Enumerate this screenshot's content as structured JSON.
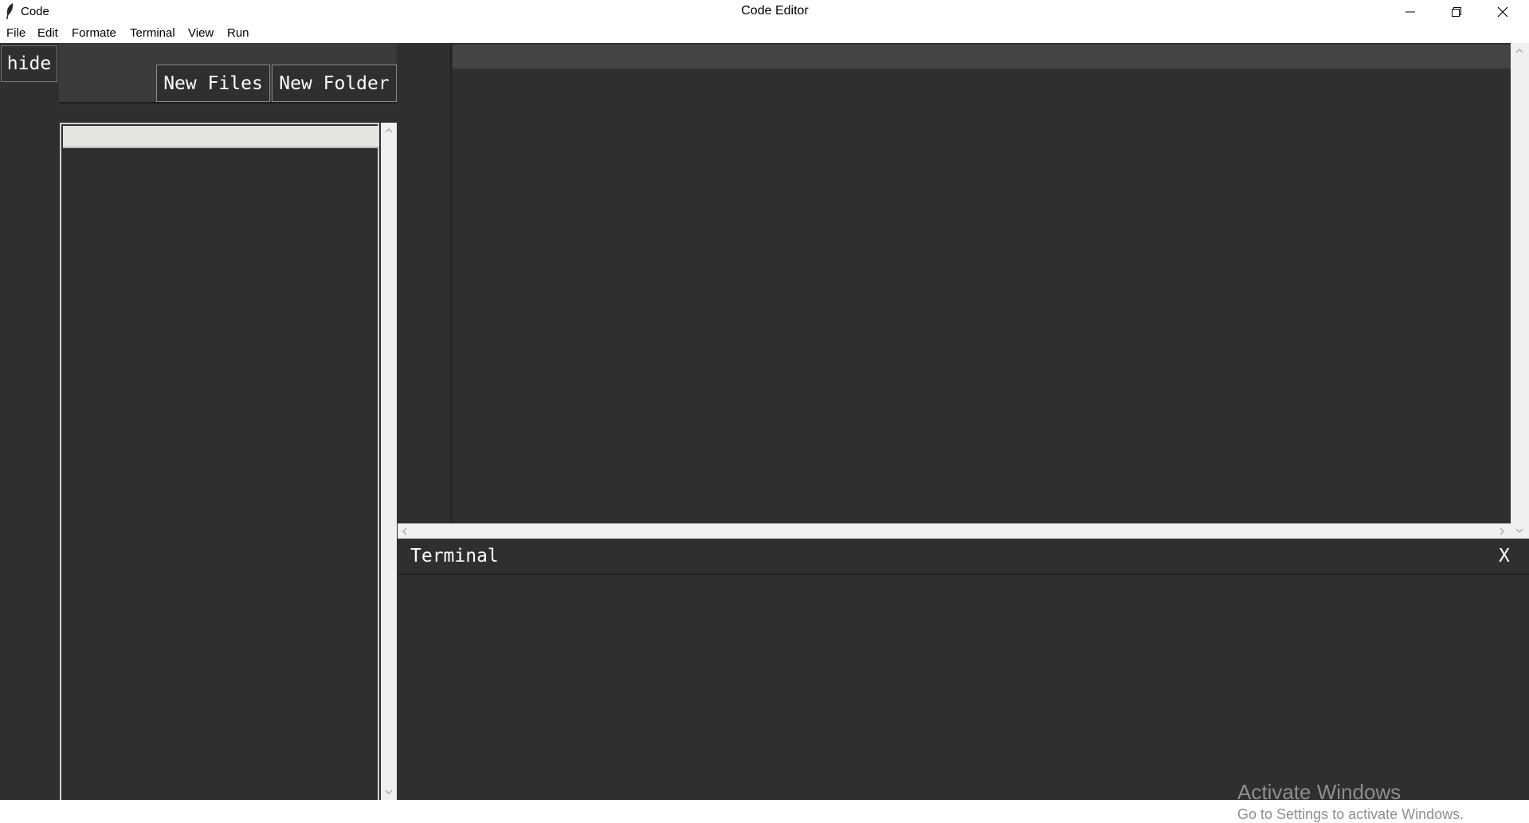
{
  "window": {
    "app_name": "Code",
    "title": "Code Editor"
  },
  "menu": {
    "file": "File",
    "edit": "Edit",
    "formate": "Formate",
    "terminal": "Terminal",
    "view": "View",
    "run": "Run"
  },
  "sidebar": {
    "hide_label": "hide",
    "new_files_label": "New Files",
    "new_folder_label": "New Folder"
  },
  "terminal": {
    "title": "Terminal",
    "close_label": "X"
  },
  "watermark": {
    "title": "Activate Windows",
    "subtitle": "Go to Settings to activate Windows."
  },
  "colors": {
    "background": "#2f2f2f",
    "toolbar": "#3b3b3b",
    "current_line": "#454545",
    "text": "#ffffff"
  }
}
